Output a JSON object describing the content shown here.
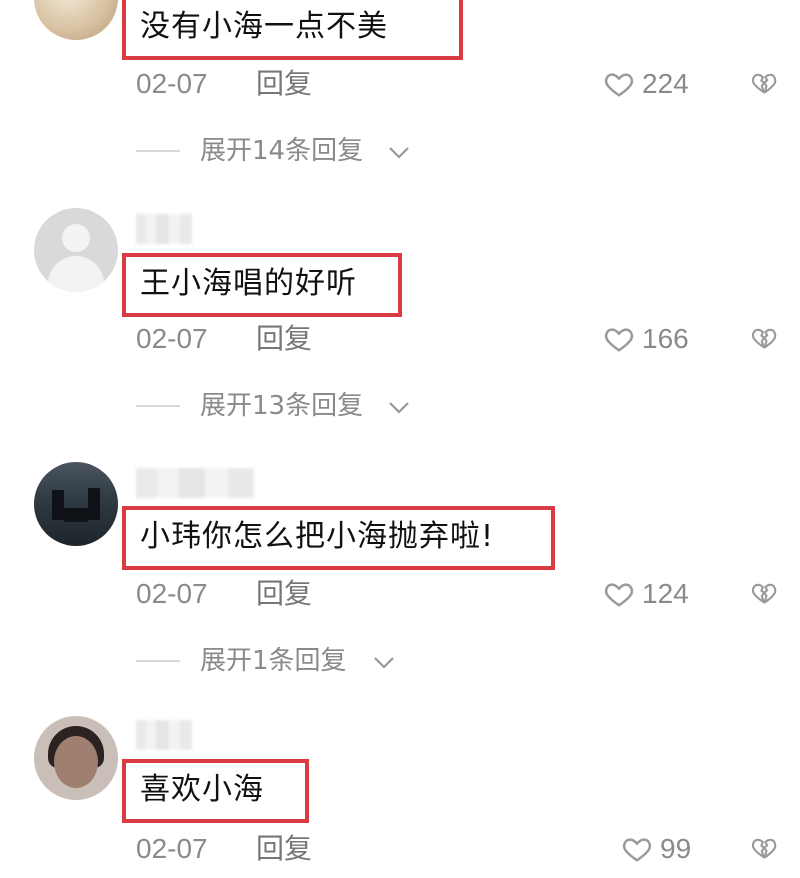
{
  "comments": [
    {
      "text": "没有小海一点不美",
      "date": "02-07",
      "reply_label": "回复",
      "likes": "224",
      "expand_label": "展开14条回复"
    },
    {
      "text": "王小海唱的好听",
      "date": "02-07",
      "reply_label": "回复",
      "likes": "166",
      "expand_label": "展开13条回复"
    },
    {
      "text": "小玮你怎么把小海抛弃啦!",
      "date": "02-07",
      "reply_label": "回复",
      "likes": "124",
      "expand_label": "展开1条回复"
    },
    {
      "text": "喜欢小海",
      "date": "02-07",
      "reply_label": "回复",
      "likes": "99"
    }
  ],
  "colors": {
    "highlight_border": "#d93b43",
    "muted_text": "#8a8a8a",
    "main_text": "#111111"
  },
  "icons": {
    "like": "heart-outline-icon",
    "dislike": "broken-heart-icon",
    "expand": "chevron-down-icon"
  }
}
